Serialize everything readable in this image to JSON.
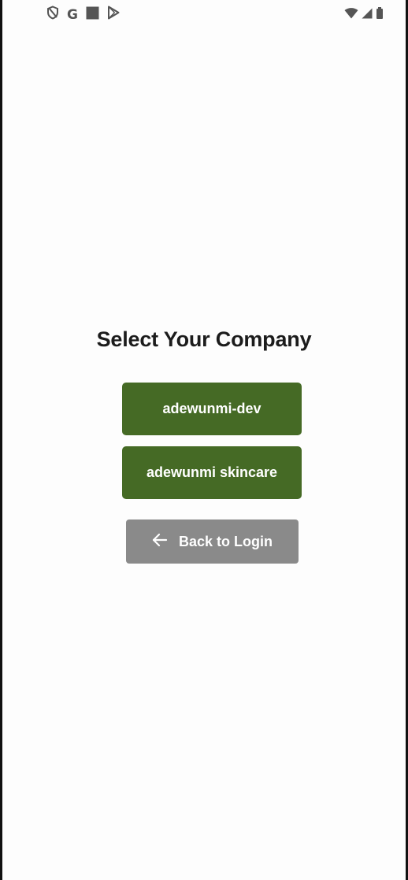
{
  "status_bar": {
    "left_icons": [
      "vpn-shield-icon",
      "google-icon",
      "square-icon",
      "play-store-icon"
    ],
    "google_letter": "G",
    "right_icons": [
      "wifi-icon",
      "cellular-signal-icon",
      "battery-icon"
    ]
  },
  "page": {
    "title": "Select Your Company"
  },
  "companies": [
    {
      "label": "adewunmi-dev"
    },
    {
      "label": "adewunmi skincare"
    }
  ],
  "back_button": {
    "label": "Back to Login",
    "icon": "arrow-left-icon"
  },
  "colors": {
    "company_button_bg": "#456a25",
    "back_button_bg": "#8a8a8a",
    "title_text": "#1c1c1c",
    "background": "#fdfdfd"
  }
}
